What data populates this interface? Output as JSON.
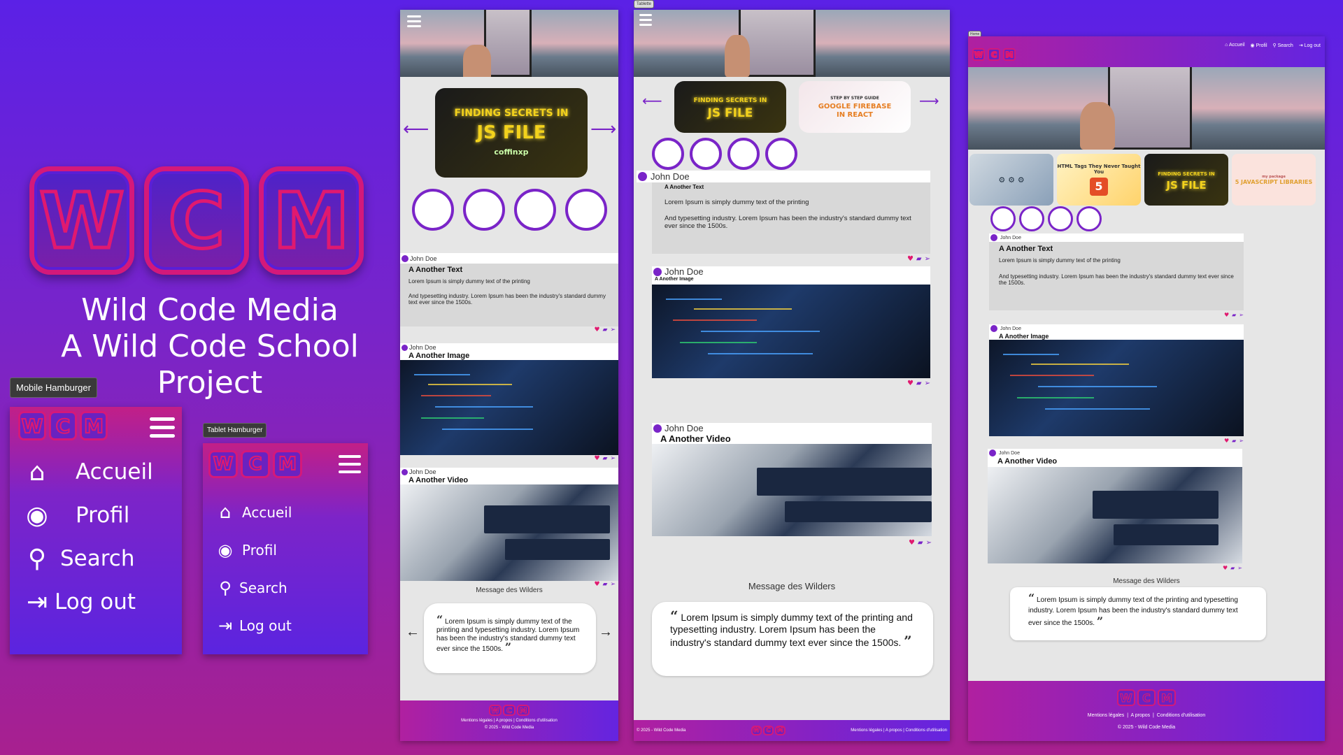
{
  "brand": {
    "letters": [
      "W",
      "C",
      "M"
    ],
    "line1": "Wild Code Media",
    "line2": "A Wild Code School Project"
  },
  "tooltips": {
    "mobile": "Mobile Hamburger",
    "tablet": "Tablet Hamburger",
    "tablet_tab": "Tablette",
    "desktop_tab": "Home"
  },
  "menu": [
    {
      "label": "Accueil",
      "icon": "home-icon"
    },
    {
      "label": "Profil",
      "icon": "profile-icon"
    },
    {
      "label": "Search",
      "icon": "search-icon"
    },
    {
      "label": "Log out",
      "icon": "logout-icon"
    }
  ],
  "carousel": {
    "js_title_line1": "FINDING SECRETS IN",
    "js_title_line2": "JS FILE",
    "js_brand": "coffinxp",
    "js_badge": "JS",
    "firebase_line1": "STEP BY STEP GUIDE",
    "firebase_line2": "GOOGLE FIREBASE",
    "firebase_line3": "IN REACT",
    "html_title": "HTML Tags They Never Taught You",
    "html_badge": "5",
    "jslib_tag": "my package",
    "jslib_title": "5 JAVASCRIPT LIBRARIES"
  },
  "posts": [
    {
      "author": "John Doe",
      "title": "A Another Text",
      "p1": "Lorem Ipsum is simply dummy text of the printing",
      "p2": "And typesetting industry. Lorem Ipsum has been the industry's standard dummy text ever since the 1500s."
    },
    {
      "author": "John Doe",
      "title": "A Another Image"
    },
    {
      "author": "John Doe",
      "title": "A Another Video"
    }
  ],
  "messages": {
    "caption": "Message des Wilders",
    "quote": "Lorem Ipsum is simply dummy text of the printing and typesetting industry. Lorem Ipsum has been the industry's standard dummy text ever since the 1500s."
  },
  "footer": {
    "links": [
      "Mentions légales",
      "A propos",
      "Conditions d'utilisation"
    ],
    "copyright": "© 2025 - Wild Code Media"
  },
  "icons": {
    "heart": "heart-icon",
    "comment": "comment-icon",
    "share": "share-icon"
  },
  "colors": {
    "accent": "#7a24c8",
    "pink": "#e0196f",
    "bg_top": "#5b21e6",
    "bg_bottom": "#a8208f"
  }
}
